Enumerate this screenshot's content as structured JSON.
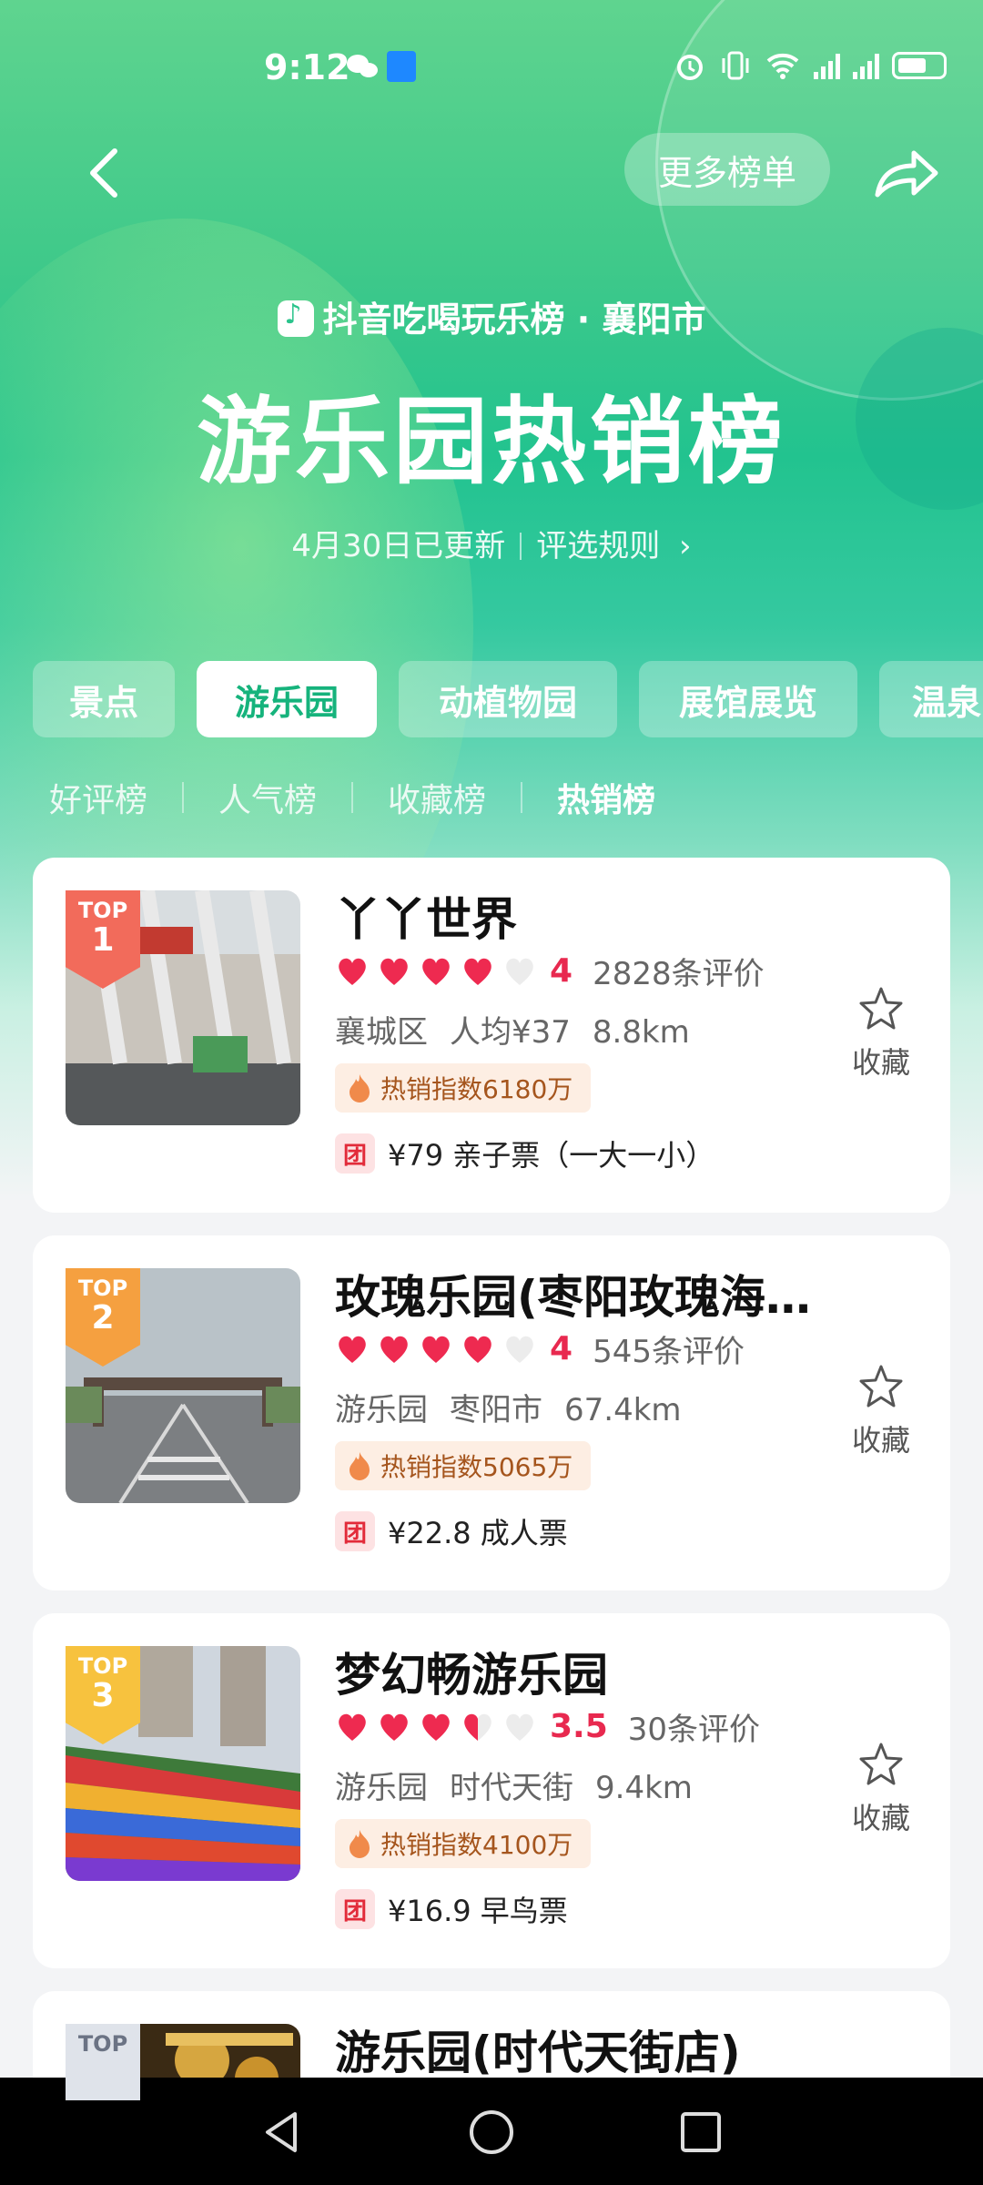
{
  "status_bar": {
    "time": "9:12"
  },
  "header": {
    "more_label": "更多榜单",
    "subtitle": "抖音吃喝玩乐榜 · 襄阳市",
    "title": "游乐园热销榜",
    "updated": "4月30日已更新",
    "rules": "评选规则"
  },
  "categories": [
    "景点",
    "游乐园",
    "动植物园",
    "展馆展览",
    "温泉"
  ],
  "subtabs": [
    "好评榜",
    "人气榜",
    "收藏榜",
    "热销榜"
  ],
  "items": [
    {
      "rank_label": "TOP",
      "rank": "1",
      "name": "丫丫世界",
      "score": "4",
      "reviews": "2828条评价",
      "district": "襄城区",
      "avg": "人均¥37",
      "distance": "8.8km",
      "hot_index": "热销指数6180万",
      "deal_tag": "团",
      "deal": "¥79 亲子票（一大一小）",
      "fav": "收藏",
      "hearts": 4
    },
    {
      "rank_label": "TOP",
      "rank": "2",
      "name": "玫瑰乐园(枣阳玫瑰海…",
      "score": "4",
      "reviews": "545条评价",
      "district": "游乐园",
      "avg": "枣阳市",
      "distance": "67.4km",
      "hot_index": "热销指数5065万",
      "deal_tag": "团",
      "deal": "¥22.8 成人票",
      "fav": "收藏",
      "hearts": 4
    },
    {
      "rank_label": "TOP",
      "rank": "3",
      "name": "梦幻畅游乐园",
      "score": "3.5",
      "reviews": "30条评价",
      "district": "游乐园",
      "avg": "时代天街",
      "distance": "9.4km",
      "hot_index": "热销指数4100万",
      "deal_tag": "团",
      "deal": "¥16.9 早鸟票",
      "fav": "收藏",
      "hearts": 3.5
    },
    {
      "rank_label": "TOP",
      "rank": "",
      "name": "游乐园(时代天街店)"
    }
  ],
  "colors": {
    "accent": "#16b37c",
    "heart": "#ee2a50",
    "rank1": "#f26b5b",
    "rank2": "#f5a040",
    "rank3": "#f7c23e"
  }
}
